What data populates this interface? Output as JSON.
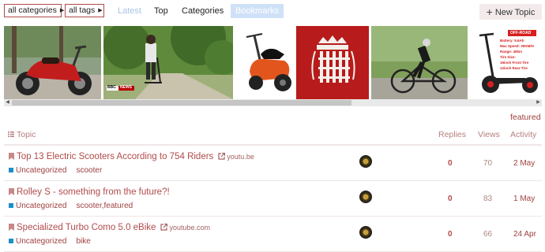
{
  "nav": {
    "category_dropdown": "all categories",
    "tags_dropdown": "all tags",
    "links": [
      "Latest",
      "Top",
      "Categories",
      "Bookmarks"
    ],
    "active": "Bookmarks",
    "new_topic_label": "New Topic",
    "new_topic_plus": "+"
  },
  "strip": {
    "bbc_badge": "BBC",
    "bbc_news": "NEWS",
    "ad_banner": "OFF-ROAD",
    "ad_specs": [
      "Battery: 9.6Ah",
      "Max Speed: 30KM/H",
      "Range: 40km",
      "Tire Size:",
      "16inch Front Tire",
      "12inch Rear Tire"
    ]
  },
  "list": {
    "featured_link": "featured",
    "headers": {
      "topic": "Topic",
      "replies": "Replies",
      "views": "Views",
      "activity": "Activity"
    },
    "topics": [
      {
        "title": "Top 13 Electric Scooters According to 754 Riders",
        "domain": "youtu.be",
        "category": "Uncategorized",
        "tags": "scooter",
        "replies": "0",
        "views": "70",
        "activity": "2 May"
      },
      {
        "title": "Rolley S - something from the future?!",
        "domain": "",
        "category": "Uncategorized",
        "tags": "scooter,featured",
        "replies": "0",
        "views": "83",
        "activity": "1 May"
      },
      {
        "title": "Specialized Turbo Como 5.0 eBike",
        "domain": "youtube.com",
        "category": "Uncategorized",
        "tags": "bike",
        "replies": "0",
        "views": "66",
        "activity": "24 Apr"
      }
    ]
  },
  "colors": {
    "accent": "#b14a4a",
    "category": "#1d8fc7",
    "active_nav_bg": "#cfe1f7",
    "new_topic_bg": "#f3ebeb"
  }
}
